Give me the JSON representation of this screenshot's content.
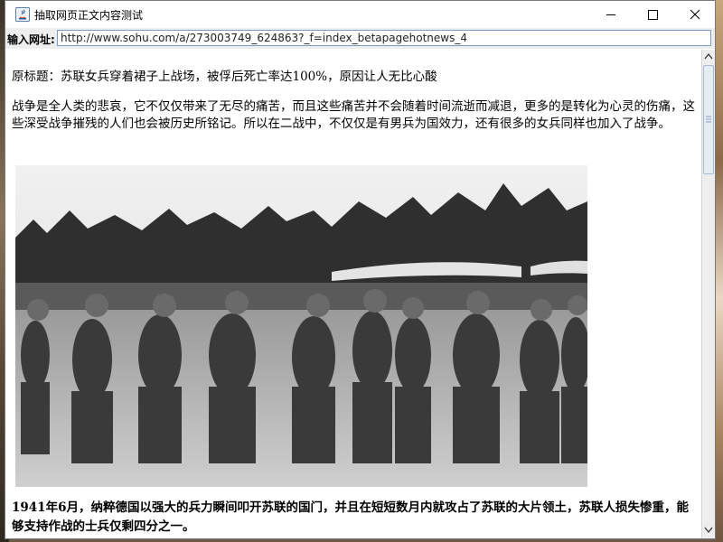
{
  "window": {
    "title": "抽取网页正文内容测试"
  },
  "urlbar": {
    "label": "输入网址:",
    "value": "http://www.sohu.com/a/273003749_624863?_f=index_betapagehotnews_4"
  },
  "article": {
    "original_title": "原标题：苏联女兵穿着裙子上战场，被俘后死亡率达100%，原因让人无比心酸",
    "intro": "战争是全人类的悲哀，它不仅仅带来了无尽的痛苦，而且这些痛苦并不会随着时间流逝而减退，更多的是转化为心灵的伤痛，这些深受战争摧残的人们也会被历史所铭记。所以在二战中，不仅仅是有男兵为国效力，还有很多的女兵同样也加入了战争。",
    "caption": "1941年6月，纳粹德国以强大的兵力瞬间叩开苏联的国门，并且在短短数月内就攻占了苏联的大片领土，苏联人损失惨重，能够支持作战的士兵仅剩四分之一。"
  },
  "icons": {
    "app": "java-app-icon",
    "minimize": "minimize-icon",
    "maximize": "maximize-icon",
    "close": "close-icon",
    "scroll_up": "scroll-up-arrow",
    "scroll_down": "scroll-down-arrow"
  },
  "colors": {
    "input_border": "#7a9cc4",
    "scroll_thumb": "#e6ecf4"
  }
}
